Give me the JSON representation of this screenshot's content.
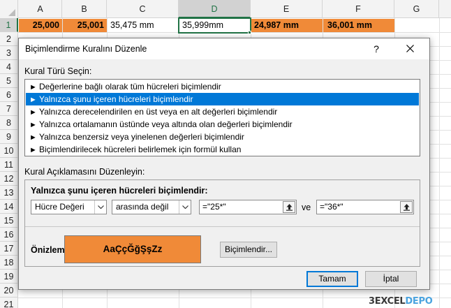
{
  "spreadsheet": {
    "columns": [
      "A",
      "B",
      "C",
      "D",
      "E",
      "F",
      "G"
    ],
    "rows": [
      "1",
      "2",
      "3",
      "4",
      "5",
      "6",
      "7",
      "8",
      "9",
      "10",
      "11",
      "12",
      "13",
      "14",
      "15",
      "16",
      "17",
      "18",
      "19",
      "20",
      "21"
    ],
    "row1_cells": {
      "A": "25,000",
      "B": "25,001",
      "C": "35,475 mm",
      "D": "35,999mm",
      "E": "24,987  mm",
      "F": "36,001  mm"
    },
    "highlight_color": "#f08a38"
  },
  "dialog": {
    "title": "Biçimlendirme Kuralını Düzenle",
    "help_label": "?",
    "rule_type_label": "Kural Türü Seçin:",
    "rule_types": [
      "Değerlerine bağlı olarak tüm hücreleri biçimlendir",
      "Yalnızca şunu içeren hücreleri biçimlendir",
      "Yalnızca derecelendirilen en üst veya en alt değerleri biçimlendir",
      "Yalnızca ortalamanın üstünde veya altında olan değerleri biçimlendir",
      "Yalnızca benzersiz veya yinelenen değerleri biçimlendir",
      "Biçimlendirilecek hücreleri belirlemek için formül kullan"
    ],
    "selected_rule_index": 1,
    "edit_label": "Kural Açıklamasını Düzenleyin:",
    "condition_heading": "Yalnızca şunu içeren hücreleri biçimlendir:",
    "condition_field": "Hücre Değeri",
    "condition_operator": "arasında değil",
    "value1": "=\"25*\"",
    "connector": "ve",
    "value2": "=\"36*\"",
    "preview_label": "Önizleme:",
    "preview_text": "AaÇçĞğŞşZz",
    "preview_color": "#f08a38",
    "format_button": "Biçimlendir...",
    "ok_button": "Tamam",
    "cancel_button": "İptal"
  },
  "watermark": {
    "part1": "EXCEL",
    "part2": "DEPO",
    "prefix": "3"
  }
}
